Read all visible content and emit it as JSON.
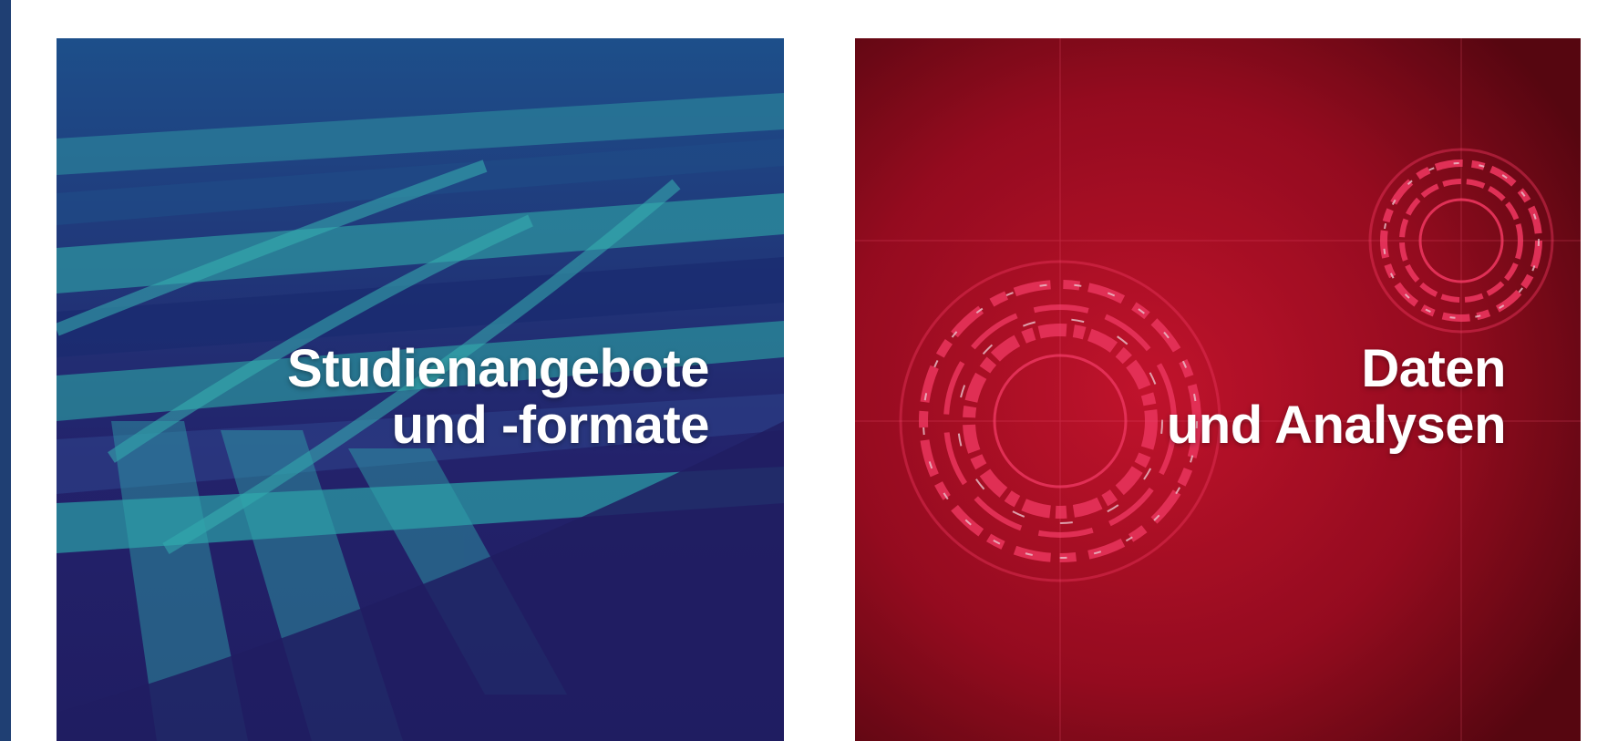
{
  "tiles": [
    {
      "title_line1": "Studienangebote",
      "title_line2": "und -formate",
      "theme_color": "#22206a",
      "accent_color": "#2a9fa6"
    },
    {
      "title_line1": "Daten",
      "title_line2": "und Analysen",
      "theme_color": "#9c0d1f",
      "accent_color": "#ff2a55"
    }
  ]
}
